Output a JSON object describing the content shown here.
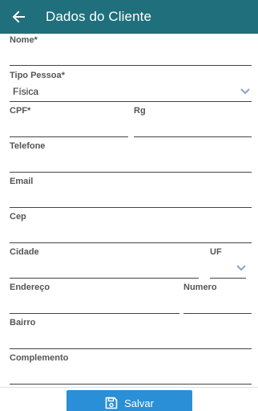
{
  "header": {
    "title": "Dados do Cliente",
    "back_icon": "arrow-left-icon"
  },
  "form": {
    "nome": {
      "label": "Nome*",
      "value": ""
    },
    "tipo_pessoa": {
      "label": "Tipo Pessoa*",
      "value": "Física"
    },
    "cpf": {
      "label": "CPF*",
      "value": ""
    },
    "rg": {
      "label": "Rg",
      "value": ""
    },
    "telefone": {
      "label": "Telefone",
      "value": ""
    },
    "email": {
      "label": "Email",
      "value": ""
    },
    "cep": {
      "label": "Cep",
      "value": ""
    },
    "cidade": {
      "label": "Cidade",
      "value": ""
    },
    "uf": {
      "label": "UF",
      "value": ""
    },
    "endereco": {
      "label": "Endereço",
      "value": ""
    },
    "numero": {
      "label": "Numero",
      "value": ""
    },
    "bairro": {
      "label": "Bairro",
      "value": ""
    },
    "complemento": {
      "label": "Complemento",
      "value": ""
    }
  },
  "actions": {
    "save_label": "Salvar",
    "save_icon": "floppy-disk-icon"
  },
  "colors": {
    "appbar": "#1f6f7c",
    "primary_button": "#2a8fd6",
    "chevron": "#8aa4c8"
  }
}
